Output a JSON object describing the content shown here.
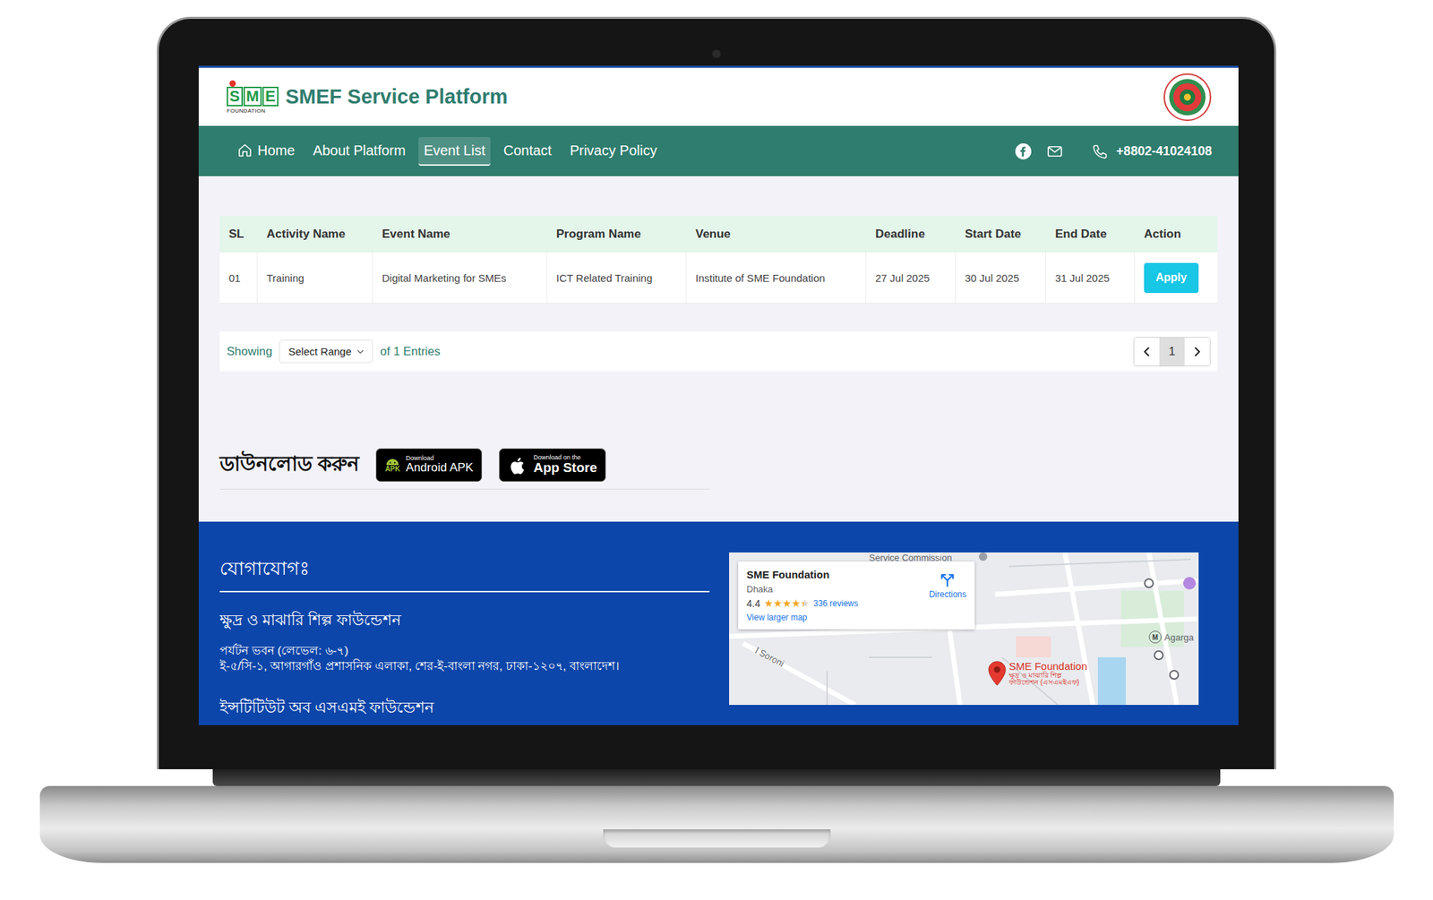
{
  "header": {
    "logo": {
      "letters": [
        "S",
        "M",
        "E"
      ],
      "tagline": "FOUNDATION"
    },
    "title": "SMEF Service Platform"
  },
  "nav": {
    "items": [
      {
        "label": "Home",
        "selected": false
      },
      {
        "label": "About Platform",
        "selected": false
      },
      {
        "label": "Event List",
        "selected": true
      },
      {
        "label": "Contact",
        "selected": false
      },
      {
        "label": "Privacy Policy",
        "selected": false
      }
    ],
    "phone": "+8802-41024108"
  },
  "table": {
    "columns": [
      "SL",
      "Activity Name",
      "Event Name",
      "Program Name",
      "Venue",
      "Deadline",
      "Start Date",
      "End Date",
      "Action"
    ],
    "rows": [
      {
        "cells": [
          "01",
          "Training",
          "Digital Marketing for SMEs",
          "ICT Related Training",
          "Institute of SME Foundation",
          "27 Jul 2025",
          "30 Jul 2025",
          "31 Jul 2025"
        ],
        "action": "Apply"
      }
    ]
  },
  "pagination": {
    "showing": "Showing",
    "select": "Select Range",
    "entries": "of 1 Entries",
    "pages": [
      {
        "label": "1",
        "selected": true
      }
    ]
  },
  "download": {
    "label": "ডাউনলোড করুন",
    "android": {
      "tag": "APK",
      "small": "Download",
      "big": "Android APK"
    },
    "ios": {
      "small": "Download on the",
      "big": "App Store"
    }
  },
  "footer": {
    "heading": "যোগাযোগঃ",
    "org": "ক্ষুদ্র ও মাঝারি শিল্প ফাউন্ডেশন",
    "address": [
      "পর্যটন ভবন (লেভেল: ৬-৭)",
      "ই-৫/সি-১, আগারগাঁও প্রশাসনিক এলাকা, শের-ই-বাংলা নগর, ঢাকা-১২০৭, বাংলাদেশ।"
    ],
    "institute": "ইন্সটিটিউট অব এসএমই ফাউন্ডেশন",
    "map": {
      "card": {
        "name": "SME Foundation",
        "place": "Dhaka",
        "rating": "4.4",
        "stars": 4.4,
        "reviews": "336 reviews",
        "link": "View larger map",
        "directions": "Directions"
      },
      "labels": [
        {
          "text": "Service Commission",
          "badge": ""
        },
        {
          "text": "Agarga",
          "badge": "M"
        },
        {
          "text": "l Soroni",
          "badge": ""
        }
      ],
      "pin": {
        "label": "SME Foundation",
        "sub": [
          "ক্ষুদ্র ও মাঝারি শিল্প",
          "ফাউন্ডেশন (এসএমইএফ)"
        ]
      }
    }
  }
}
